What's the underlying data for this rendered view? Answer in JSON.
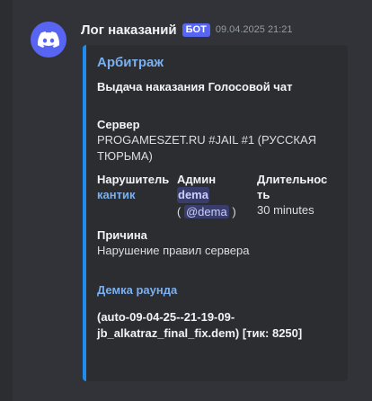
{
  "message": {
    "author": "Лог наказаний",
    "badge": "БОТ",
    "timestamp": "09.04.2025 21:21",
    "avatar_icon": "discord-logo-icon"
  },
  "embed": {
    "accent_color": "#1e8cf0",
    "author": "Арбитраж",
    "title": "Выдача наказания Голосовой чат",
    "server": {
      "name": "Сервер",
      "value_line1": "PROGAMESZET.RU #JAIL #1 (РУССКАЯ",
      "value_line2": "ТЮРЬМА)"
    },
    "violator": {
      "name": "Нарушитель",
      "value": "кантик"
    },
    "admin": {
      "name": "Админ",
      "value": "dema",
      "open_paren": "(",
      "mention": "@dema",
      "close_paren": ")"
    },
    "duration": {
      "name_line1": "Длительнос",
      "name_line2": "ть",
      "value": "30 minutes"
    },
    "reason": {
      "name": "Причина",
      "value": "Нарушение правил сервера"
    },
    "demo": {
      "name": "Демка раунда",
      "value_line1": "(auto-09-04-25--21-19-09-",
      "value_line2": "jb_alkatraz_final_fix.dem) [тик: 8250]"
    }
  }
}
